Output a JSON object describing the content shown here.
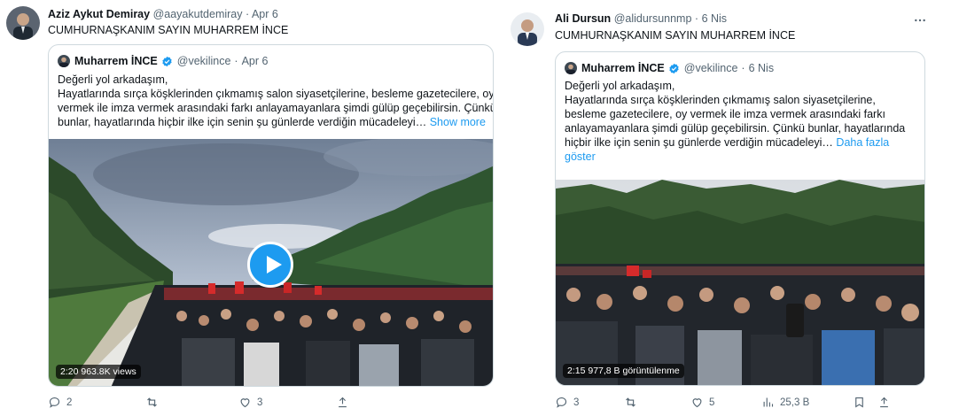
{
  "left_tweet": {
    "author_name": "Aziz Aykut Demiray",
    "handle": "@aayakutdemiray",
    "date": "Apr 6",
    "text": "CUMHURNAŞKANIM SAYIN MUHARREM İNCE",
    "quote": {
      "author_name": "Muharrem İNCE",
      "handle": "@vekilince",
      "date": "Apr 6",
      "lines": [
        "Değerli yol arkadaşım,",
        "Hayatlarında sırça köşklerinden çıkmamış salon siyasetçilerine, besleme gazetecilere, oy",
        "vermek ile imza vermek arasındaki farkı anlayamayanlara şimdi gülüp geçebilirsin. Çünkü",
        "bunlar, hayatlarında hiçbir ilke için senin şu günlerde verdiğin mücadeleyi…"
      ],
      "show_more": "Show more",
      "video_duration": "2:20",
      "video_views": "963.8K views"
    },
    "actions": {
      "replies": "2",
      "retweets": "",
      "likes": "3"
    }
  },
  "right_tweet": {
    "author_name": "Ali Dursun",
    "handle": "@alidursunnmp",
    "date": "6 Nis",
    "text": "CUMHURNAŞKANIM SAYIN MUHARREM İNCE",
    "quote": {
      "author_name": "Muharrem İNCE",
      "handle": "@vekilince",
      "date": "6 Nis",
      "lines": [
        "Değerli yol arkadaşım,",
        "Hayatlarında sırça köşklerinden çıkmamış salon siyasetçilerine,",
        "besleme gazetecilere, oy vermek ile imza vermek arasındaki farkı",
        "anlayamayanlara şimdi gülüp geçebilirsin. Çünkü bunlar, hayatlarında",
        "hiçbir ilke için senin şu günlerde verdiğin mücadeleyi…"
      ],
      "show_more_1": "Daha fazla",
      "show_more_2": "göster",
      "video_duration": "2:15",
      "video_views": "977,8 B görüntülenme"
    },
    "actions": {
      "replies": "3",
      "retweets": "",
      "likes": "5",
      "views": "25,3 B"
    }
  },
  "colors": {
    "accent": "#1d9bf0",
    "muted": "#536471",
    "border": "#cfd9de",
    "text": "#0f1419"
  },
  "icons": [
    "reply-icon",
    "retweet-icon",
    "like-icon",
    "views-icon",
    "bookmark-icon",
    "share-icon",
    "verified-badge-icon",
    "play-icon",
    "more-icon"
  ]
}
